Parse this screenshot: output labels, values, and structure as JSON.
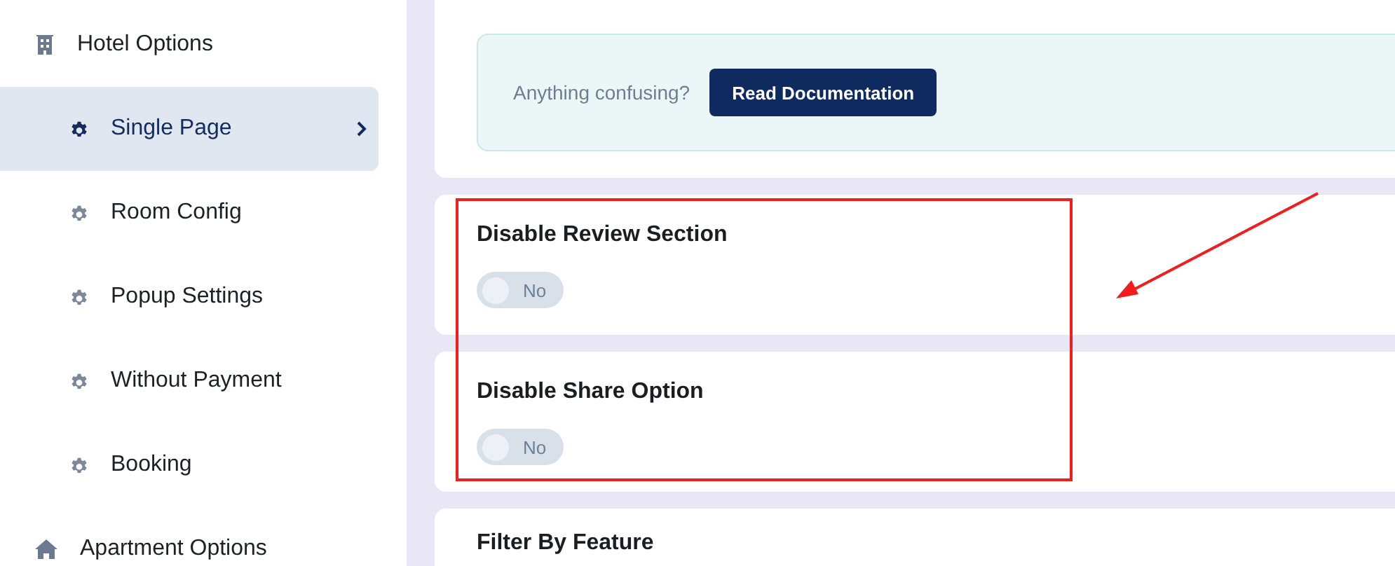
{
  "sidebar": {
    "items": [
      {
        "label": "Hotel Options",
        "selected": false,
        "children": [
          {
            "label": "Single Page",
            "selected": true
          },
          {
            "label": "Room Config",
            "selected": false
          },
          {
            "label": "Popup Settings",
            "selected": false
          },
          {
            "label": "Without Payment",
            "selected": false
          },
          {
            "label": "Booking",
            "selected": false
          }
        ]
      },
      {
        "label": "Apartment Options",
        "selected": false
      }
    ]
  },
  "help_box": {
    "text": "Anything confusing?",
    "button": "Read Documentation"
  },
  "settings": [
    {
      "title": "Disable Review Section",
      "toggle": {
        "checked": false,
        "label": "No"
      }
    },
    {
      "title": "Disable Share Option",
      "toggle": {
        "checked": false,
        "label": "No"
      }
    },
    {
      "title": "Filter By Feature"
    }
  ]
}
